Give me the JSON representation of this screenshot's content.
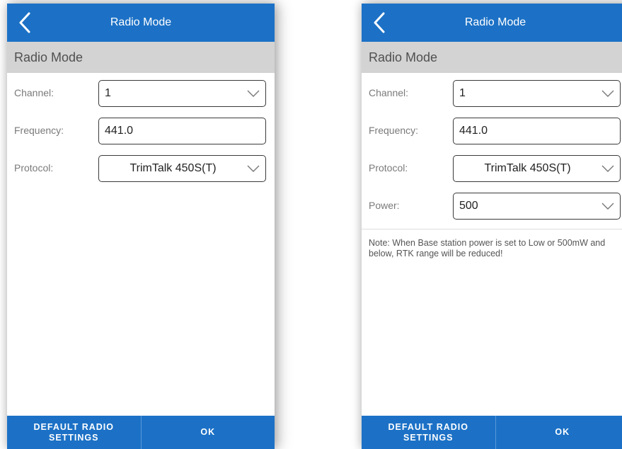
{
  "screens": [
    {
      "appbar_title": "Radio Mode",
      "section_title": "Radio Mode",
      "fields": [
        {
          "label": "Channel:",
          "value": "1"
        },
        {
          "label": "Frequency:",
          "value": "441.0"
        },
        {
          "label": "Protocol:",
          "value": "TrimTalk 450S(T)"
        }
      ],
      "buttons": {
        "default": "DEFAULT RADIO\nSETTINGS",
        "ok": "OK"
      }
    },
    {
      "appbar_title": "Radio Mode",
      "section_title": "Radio Mode",
      "fields": [
        {
          "label": "Channel:",
          "value": "1"
        },
        {
          "label": "Frequency:",
          "value": "441.0"
        },
        {
          "label": "Protocol:",
          "value": "TrimTalk 450S(T)"
        },
        {
          "label": "Power:",
          "value": "500"
        }
      ],
      "note": "Note: When Base station power is set to Low or 500mW and below, RTK range will be reduced!",
      "buttons": {
        "default": "DEFAULT RADIO\nSETTINGS",
        "ok": "OK"
      }
    }
  ],
  "colors": {
    "primary": "#1c71c6",
    "section_bg": "#d3d3d3"
  },
  "icons": {
    "back": "chevron-left-icon",
    "dropdown": "chevron-down-icon"
  }
}
